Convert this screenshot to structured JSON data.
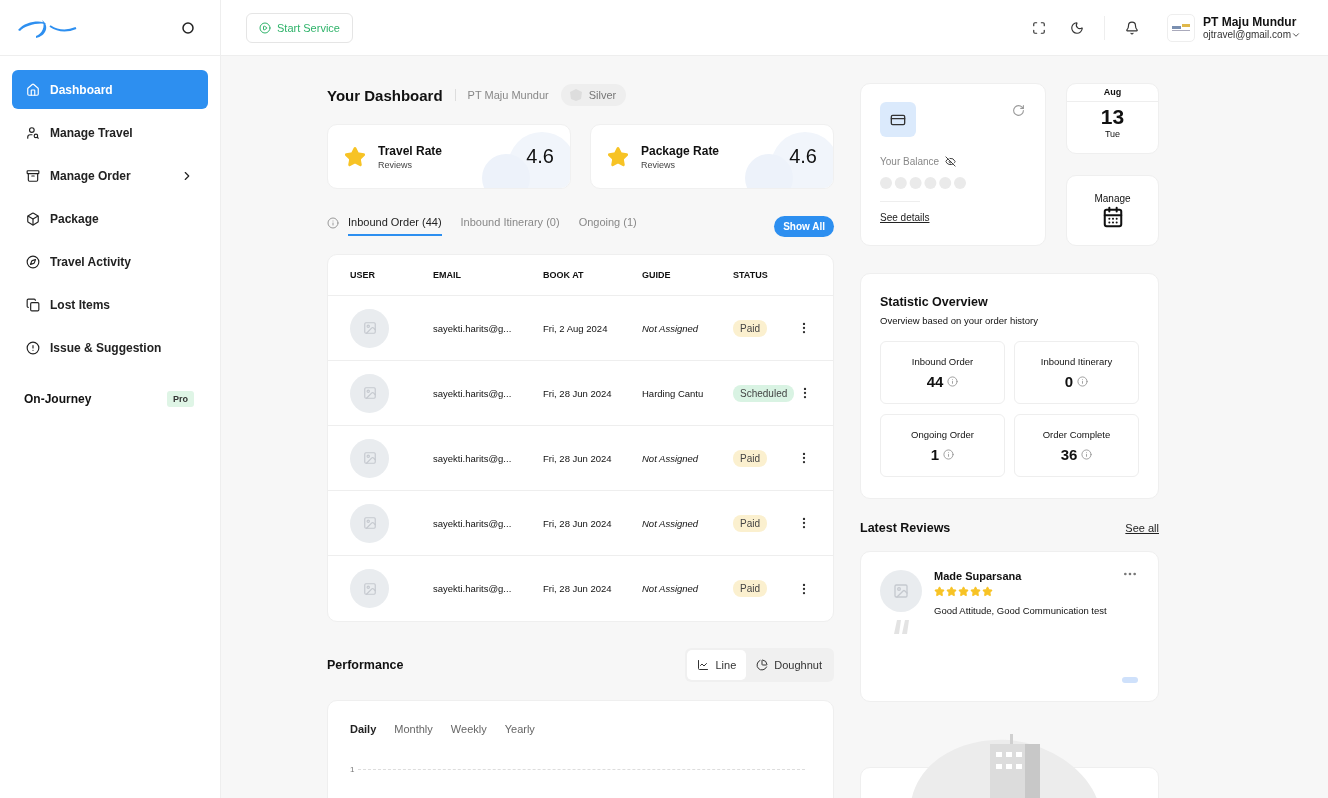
{
  "header": {
    "start_service": "Start Service",
    "user": {
      "name": "PT Maju Mundur",
      "email": "ojtravel@gmail.com"
    }
  },
  "sidebar": {
    "items": [
      {
        "label": "Dashboard",
        "selected": true,
        "kind": "link"
      },
      {
        "label": "Manage Travel",
        "selected": false,
        "kind": "link"
      },
      {
        "label": "Manage Order",
        "selected": false,
        "kind": "submenu"
      },
      {
        "label": "Package",
        "selected": false,
        "kind": "link"
      },
      {
        "label": "Travel Activity",
        "selected": false,
        "kind": "link"
      },
      {
        "label": "Lost Items",
        "selected": false,
        "kind": "link"
      },
      {
        "label": "Issue & Suggestion",
        "selected": false,
        "kind": "link"
      }
    ],
    "section": {
      "label": "On-Journey",
      "badge": "Pro"
    }
  },
  "dashboard": {
    "title": "Your Dashboard",
    "company": "PT Maju Mundur",
    "tier": "Silver"
  },
  "rates": [
    {
      "title": "Travel Rate",
      "subtitle": "Reviews",
      "value": "4.6"
    },
    {
      "title": "Package Rate",
      "subtitle": "Reviews",
      "value": "4.6"
    }
  ],
  "tabs": [
    {
      "label": "Inbound Order (44)",
      "selected": true
    },
    {
      "label": "Inbound Itinerary (0)",
      "selected": false
    },
    {
      "label": "Ongoing (1)",
      "selected": false
    }
  ],
  "show_all": "Show All",
  "table": {
    "columns": [
      "USER",
      "EMAIL",
      "BOOK AT",
      "GUIDE",
      "STATUS"
    ],
    "rows": [
      {
        "email": "sayekti.harits@g...",
        "book_at": "Fri, 2 Aug 2024",
        "guide": "Not Assigned",
        "assigned": false,
        "status": "Paid",
        "color": "#fbf0cf"
      },
      {
        "email": "sayekti.harits@g...",
        "book_at": "Fri, 28 Jun 2024",
        "guide": "Harding Cantu",
        "assigned": true,
        "status": "Scheduled",
        "color": "#d9f3e3"
      },
      {
        "email": "sayekti.harits@g...",
        "book_at": "Fri, 28 Jun 2024",
        "guide": "Not Assigned",
        "assigned": false,
        "status": "Paid",
        "color": "#fbf0cf"
      },
      {
        "email": "sayekti.harits@g...",
        "book_at": "Fri, 28 Jun 2024",
        "guide": "Not Assigned",
        "assigned": false,
        "status": "Paid",
        "color": "#fbf0cf"
      },
      {
        "email": "sayekti.harits@g...",
        "book_at": "Fri, 28 Jun 2024",
        "guide": "Not Assigned",
        "assigned": false,
        "status": "Paid",
        "color": "#fbf0cf"
      }
    ]
  },
  "performance": {
    "title": "Performance",
    "views": [
      {
        "label": "Line",
        "selected": true
      },
      {
        "label": "Doughnut",
        "selected": false
      }
    ],
    "periods": [
      {
        "label": "Daily",
        "selected": true
      },
      {
        "label": "Monthly",
        "selected": false
      },
      {
        "label": "Weekly",
        "selected": false
      },
      {
        "label": "Yearly",
        "selected": false
      }
    ],
    "y_tick": "1"
  },
  "balance": {
    "label": "Your Balance",
    "link": "See details"
  },
  "date": {
    "month": "Aug",
    "day": "13",
    "weekday": "Tue"
  },
  "manage": "Manage",
  "statistics": {
    "title": "Statistic Overview",
    "subtitle": "Overview based on your order history",
    "items": [
      {
        "label": "Inbound Order",
        "value": "44"
      },
      {
        "label": "Inbound Itinerary",
        "value": "0"
      },
      {
        "label": "Ongoing Order",
        "value": "1"
      },
      {
        "label": "Order Complete",
        "value": "36"
      }
    ]
  },
  "reviews": {
    "title": "Latest Reviews",
    "see_all": "See all",
    "items": [
      {
        "name": "Made Suparsana",
        "stars": 5,
        "text": "Good Attitude, Good Communication test"
      }
    ]
  }
}
